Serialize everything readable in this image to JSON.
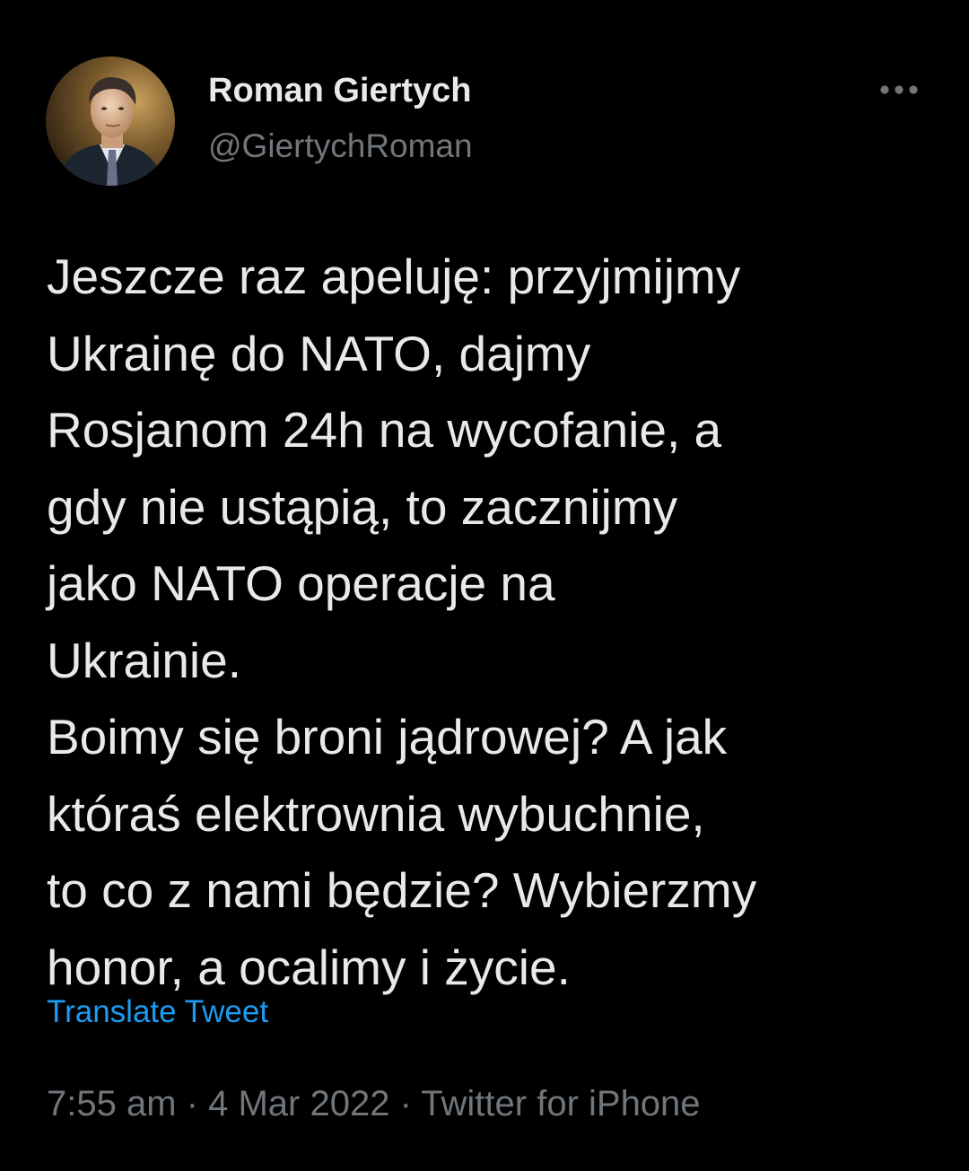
{
  "author": {
    "display_name": "Roman Giertych",
    "handle": "@GiertychRoman"
  },
  "tweet": {
    "lines": [
      "Jeszcze raz apeluję: przyjmijmy",
      "Ukrainę do NATO, dajmy",
      "Rosjanom 24h na wycofanie, a",
      "gdy nie ustąpią, to zacznijmy",
      "jako NATO operacje na",
      "Ukrainie.",
      "Boimy się broni jądrowej? A jak",
      "któraś elektrownia wybuchnie,",
      "to co z nami będzie? Wybierzmy",
      "honor, a ocalimy i życie."
    ],
    "translate_label": "Translate Tweet"
  },
  "meta": {
    "time": "7:55 am",
    "separator": "·",
    "date": "4 Mar 2022",
    "source": "Twitter for iPhone"
  },
  "icons": {
    "more": "more-horizontal-icon"
  },
  "colors": {
    "background": "#000000",
    "text_primary": "#e7e9ea",
    "text_secondary": "#71767b",
    "link": "#1d9bf0"
  }
}
